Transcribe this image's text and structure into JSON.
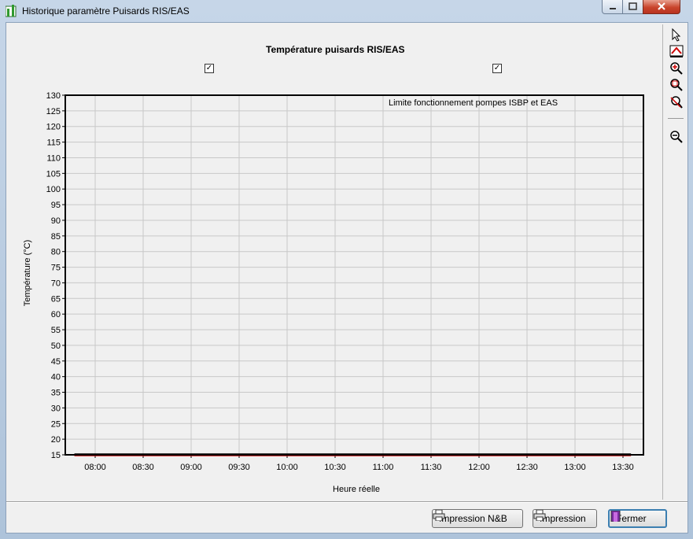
{
  "window": {
    "title": "Historique paramètre Puisards RIS/EAS"
  },
  "chart_title": "Température puisards RIS/EAS",
  "checkboxes": [
    {
      "checked": true
    },
    {
      "checked": true
    }
  ],
  "buttons": {
    "print_bw": "Impression N&B",
    "print": "Impression",
    "close": "Fermer"
  },
  "toolbar_icons": [
    "cursor-icon",
    "zoom-fit-icon",
    "zoom-in-icon",
    "zoom-box-icon",
    "zoom-reset-icon",
    "zoom-out-icon"
  ],
  "chart_data": {
    "type": "line",
    "title": "Température puisards RIS/EAS",
    "xlabel": "Heure réelle",
    "ylabel": "Température (°C)",
    "ylim": [
      15,
      130
    ],
    "yticks": [
      15,
      20,
      25,
      30,
      35,
      40,
      45,
      50,
      55,
      60,
      65,
      70,
      75,
      80,
      85,
      90,
      95,
      100,
      105,
      110,
      115,
      120,
      125,
      130
    ],
    "xticks": [
      "08:00",
      "08:30",
      "09:00",
      "09:30",
      "10:00",
      "10:30",
      "11:00",
      "11:30",
      "12:00",
      "12:30",
      "13:00",
      "13:30"
    ],
    "annotation": "Limite fonctionnement pompes ISBP et EAS",
    "grid": true,
    "series": [
      {
        "color": "#000000",
        "x": [
          "07:47",
          "13:35"
        ],
        "y": [
          15.2,
          15.2
        ]
      },
      {
        "color": "#cc0000",
        "x": [
          "07:47",
          "13:35"
        ],
        "y": [
          14.8,
          14.8
        ]
      }
    ]
  },
  "colors": {
    "grid": "#c8c8c8",
    "series_black": "#000000",
    "series_red": "#cc0000"
  }
}
